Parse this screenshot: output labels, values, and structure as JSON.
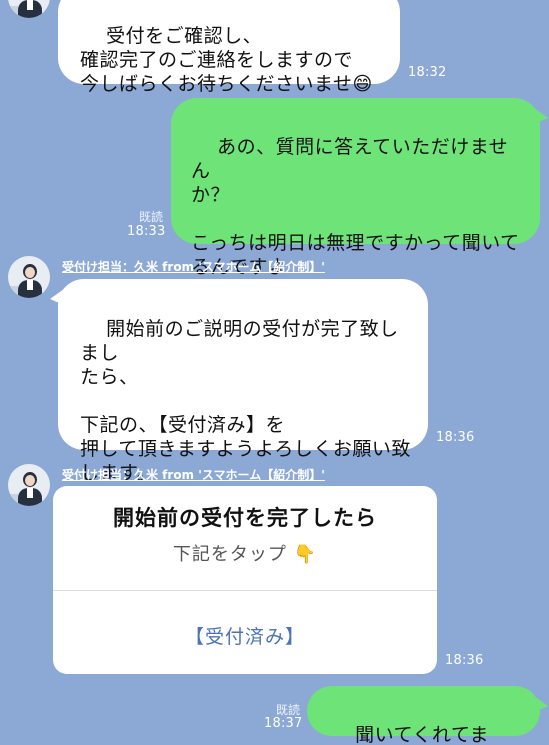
{
  "messages": {
    "m1": {
      "text": "受付をご確認し、\n確認完了のご連絡をしますので\n今しばらくお待ちくださいませ",
      "emoji": "😄",
      "time": "18:32"
    },
    "m2": {
      "text": "あの、質問に答えていただけません\nか？\n\nこっちは明日は無理ですかって聞いて\nるんですよ",
      "read": "既読",
      "time": "18:33"
    },
    "m3": {
      "sender": "受付け担当：久米 from 'スマホーム【紹介制】'",
      "text": "開始前のご説明の受付が完了致しまし\nたら、\n\n下記の、【受付済み】を\n押して頂きますようよろしくお願い致\nします。",
      "time": "18:36"
    },
    "m4": {
      "sender": "受付け担当：久米 from 'スマホーム【紹介制】'",
      "card_title": "開始前の受付を完了したら",
      "card_sub": "下記をタップ",
      "card_sub_emoji": "👇",
      "card_action": "【受付済み】",
      "time": "18:36"
    },
    "m5": {
      "text": "聞いてくれてます？笑",
      "read": "既読",
      "time": "18:37"
    }
  },
  "colors": {
    "background": "#8ca9d6",
    "incoming_bubble": "#ffffff",
    "outgoing_bubble": "#6ee378",
    "link": "#4a73b8"
  }
}
